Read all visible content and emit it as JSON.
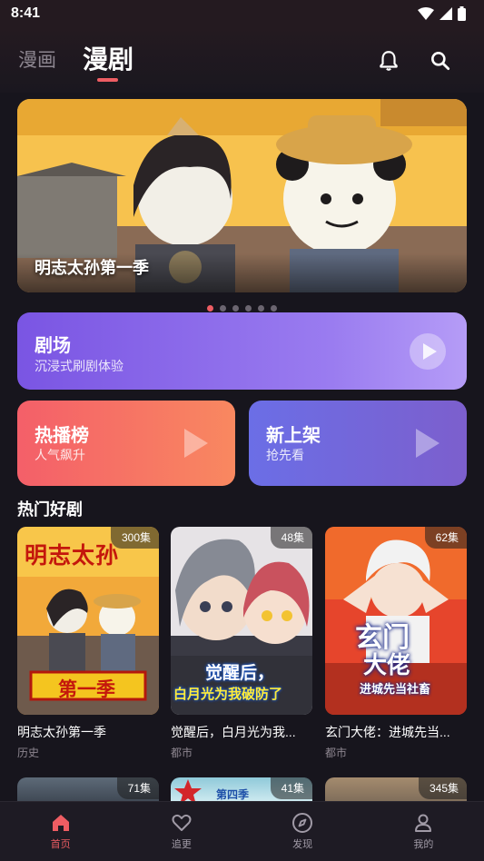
{
  "status_bar": {
    "time": "8:41"
  },
  "header": {
    "tabs": [
      {
        "label": "漫画",
        "active": false
      },
      {
        "label": "漫剧",
        "active": true
      }
    ],
    "accent_color": "#ee5d63"
  },
  "banner": {
    "title": "明志太孙第一季",
    "page_count": 6,
    "active_index": 0
  },
  "theater": {
    "title": "剧场",
    "subtitle": "沉浸式刷剧体验"
  },
  "hot_list": {
    "title": "热播榜",
    "subtitle": "人气飙升"
  },
  "new_arrivals": {
    "title": "新上架",
    "subtitle": "抢先看"
  },
  "section": {
    "title": "热门好剧"
  },
  "dramas": [
    {
      "title": "明志太孙第一季",
      "tag": "历史",
      "episodes": "300集",
      "poster_text_top": "明志太孙",
      "poster_text_bottom": "第一季"
    },
    {
      "title": "觉醒后，白月光为我...",
      "tag": "都市",
      "episodes": "48集",
      "poster_text_top": "觉醒后，",
      "poster_text_bottom": "白月光为我破防了"
    },
    {
      "title": "玄门大佬：进城先当...",
      "tag": "都市",
      "episodes": "62集",
      "poster_text_top": "玄门",
      "poster_text_mid": "大佬",
      "poster_text_bottom": "进城先当社畜"
    }
  ],
  "dramas_partial": [
    {
      "episodes": "71集"
    },
    {
      "episodes": "41集",
      "poster_text": "第四季"
    },
    {
      "episodes": "345集"
    }
  ],
  "bottom_nav": [
    {
      "label": "首页",
      "icon": "home-icon",
      "active": true
    },
    {
      "label": "追更",
      "icon": "heart-icon",
      "active": false
    },
    {
      "label": "发现",
      "icon": "compass-icon",
      "active": false
    },
    {
      "label": "我的",
      "icon": "user-icon",
      "active": false
    }
  ]
}
